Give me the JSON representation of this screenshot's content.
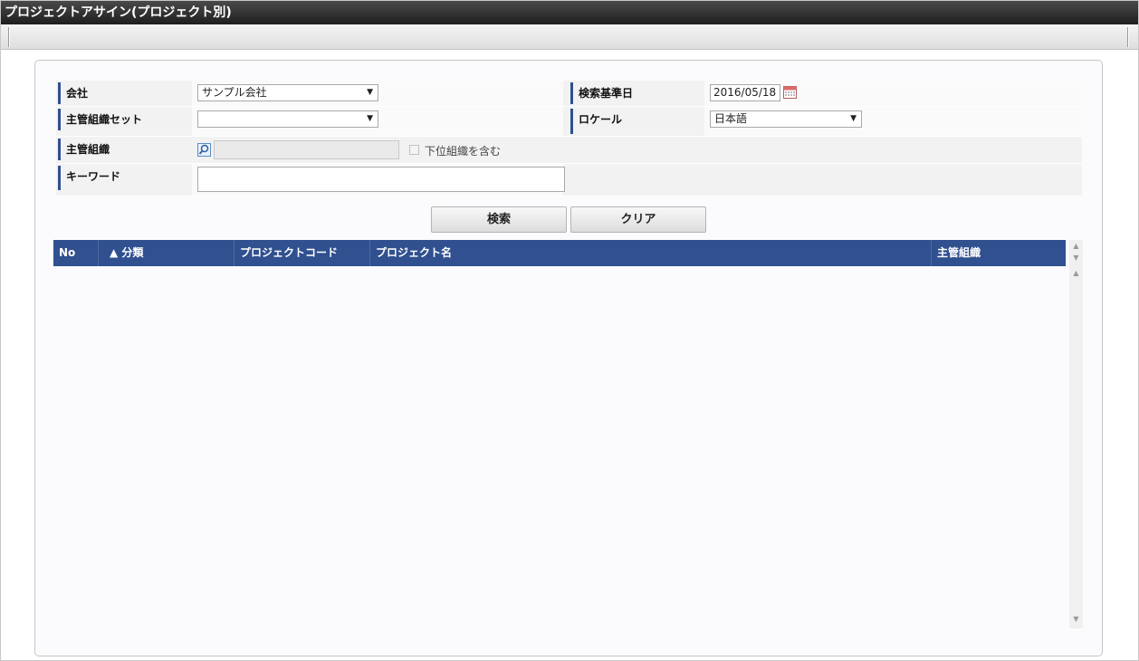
{
  "window": {
    "title": "プロジェクトアサイン(プロジェクト別)"
  },
  "form": {
    "company": {
      "label": "会社",
      "value": "サンプル会社"
    },
    "base_date": {
      "label": "検索基準日",
      "value": "2016/05/18"
    },
    "org_set": {
      "label": "主管組織セット",
      "value": ""
    },
    "locale": {
      "label": "ロケール",
      "value": "日本語"
    },
    "org": {
      "label": "主管組織",
      "value": "",
      "include_sub_label": "下位組織を含む",
      "include_sub_checked": false
    },
    "keyword": {
      "label": "キーワード",
      "value": ""
    }
  },
  "buttons": {
    "search": "検索",
    "clear": "クリア"
  },
  "grid": {
    "columns": [
      "No",
      "▲ 分類",
      "プロジェクトコード",
      "プロジェクト名",
      "主管組織"
    ],
    "rows": []
  },
  "colors": {
    "accent": "#30508f",
    "titlebar": "#2b2b2b"
  },
  "icons": {
    "calendar": "calendar-icon",
    "search": "search-icon",
    "sort": "sort-asc-icon"
  }
}
